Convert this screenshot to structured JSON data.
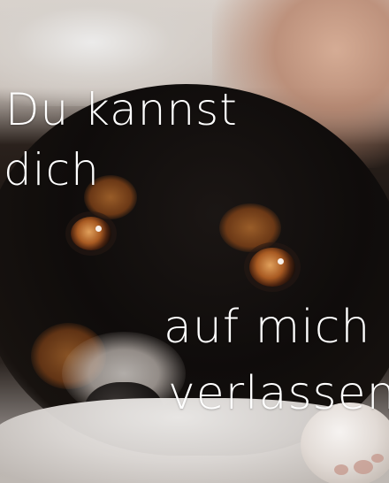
{
  "image": {
    "text": {
      "line1": "Du kannst",
      "line2": "dich",
      "line3": "auf mich",
      "line4": "verlassen"
    }
  }
}
